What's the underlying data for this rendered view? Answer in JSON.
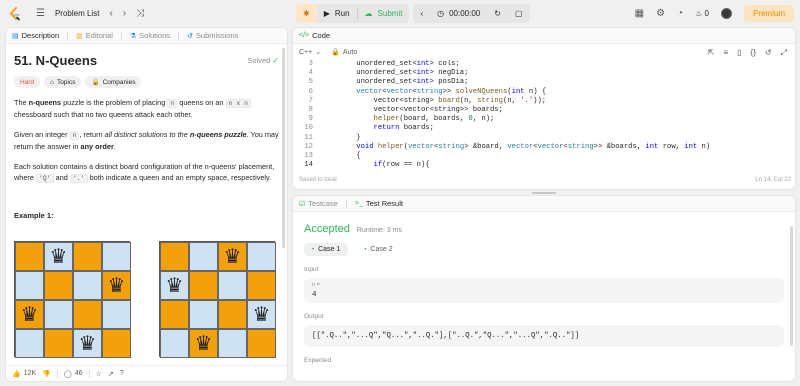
{
  "topnav": {
    "problem_list": "Problem List",
    "run": "Run",
    "submit": "Submit",
    "timer": "00:00:00",
    "streak": "0",
    "premium": "Premium"
  },
  "left": {
    "tabs": [
      "Description",
      "Editorial",
      "Solutions",
      "Submissions"
    ],
    "title": "51. N-Queens",
    "solved": "Solved",
    "badges": [
      "Hard",
      "Topics",
      "Companies"
    ],
    "p1_a": "The ",
    "p1_b": "n-queens",
    "p1_c": " puzzle is the problem of placing ",
    "p1_n": "n",
    "p1_d": " queens on an ",
    "p1_nxn": "n x n",
    "p1_e": " chessboard such that no two queens attack each other.",
    "p2_a": "Given an integer ",
    "p2_n": "n",
    "p2_b": ", return ",
    "p2_c": "all distinct solutions to the ",
    "p2_d": "n-queens puzzle",
    "p2_e": ". You may return the answer in ",
    "p2_f": "any order",
    "p2_g": ".",
    "p3_a": "Each solution contains a distinct board configuration of the n-queens' placement, where ",
    "p3_q": "'Q'",
    "p3_b": " and ",
    "p3_dot": "'.'",
    "p3_c": " both indicate a queen and an empty space, respectively.",
    "example_title": "Example 1:",
    "likes": "12K",
    "comments": "46"
  },
  "editor": {
    "tab": "Code",
    "language": "C++",
    "auto": "Auto",
    "saved": "Saved to local",
    "position": "Ln 14, Col 22",
    "line_numbers": [
      "3",
      "4",
      "5",
      "6",
      "7",
      "8",
      "9",
      "10",
      "11",
      "12",
      "13",
      "14"
    ]
  },
  "result": {
    "tabs": [
      "Testcase",
      "Test Result"
    ],
    "status": "Accepted",
    "runtime": "Runtime: 3 ms",
    "cases": [
      "Case 1",
      "Case 2"
    ],
    "input_label": "Input",
    "var_name": "n =",
    "var_value": "4",
    "output_label": "Output",
    "output_value": "[[\".Q..\",\"...Q\",\"Q...\",\"..Q.\"],[\"..Q.\",\"Q...\",\"...Q\",\".Q..\"]]",
    "expected_label": "Expected"
  },
  "colors": {
    "accent_green": "#2db55d",
    "hard_red": "#ef4743",
    "board_orange": "#f2a10c",
    "board_blue": "#cfe2f3"
  }
}
